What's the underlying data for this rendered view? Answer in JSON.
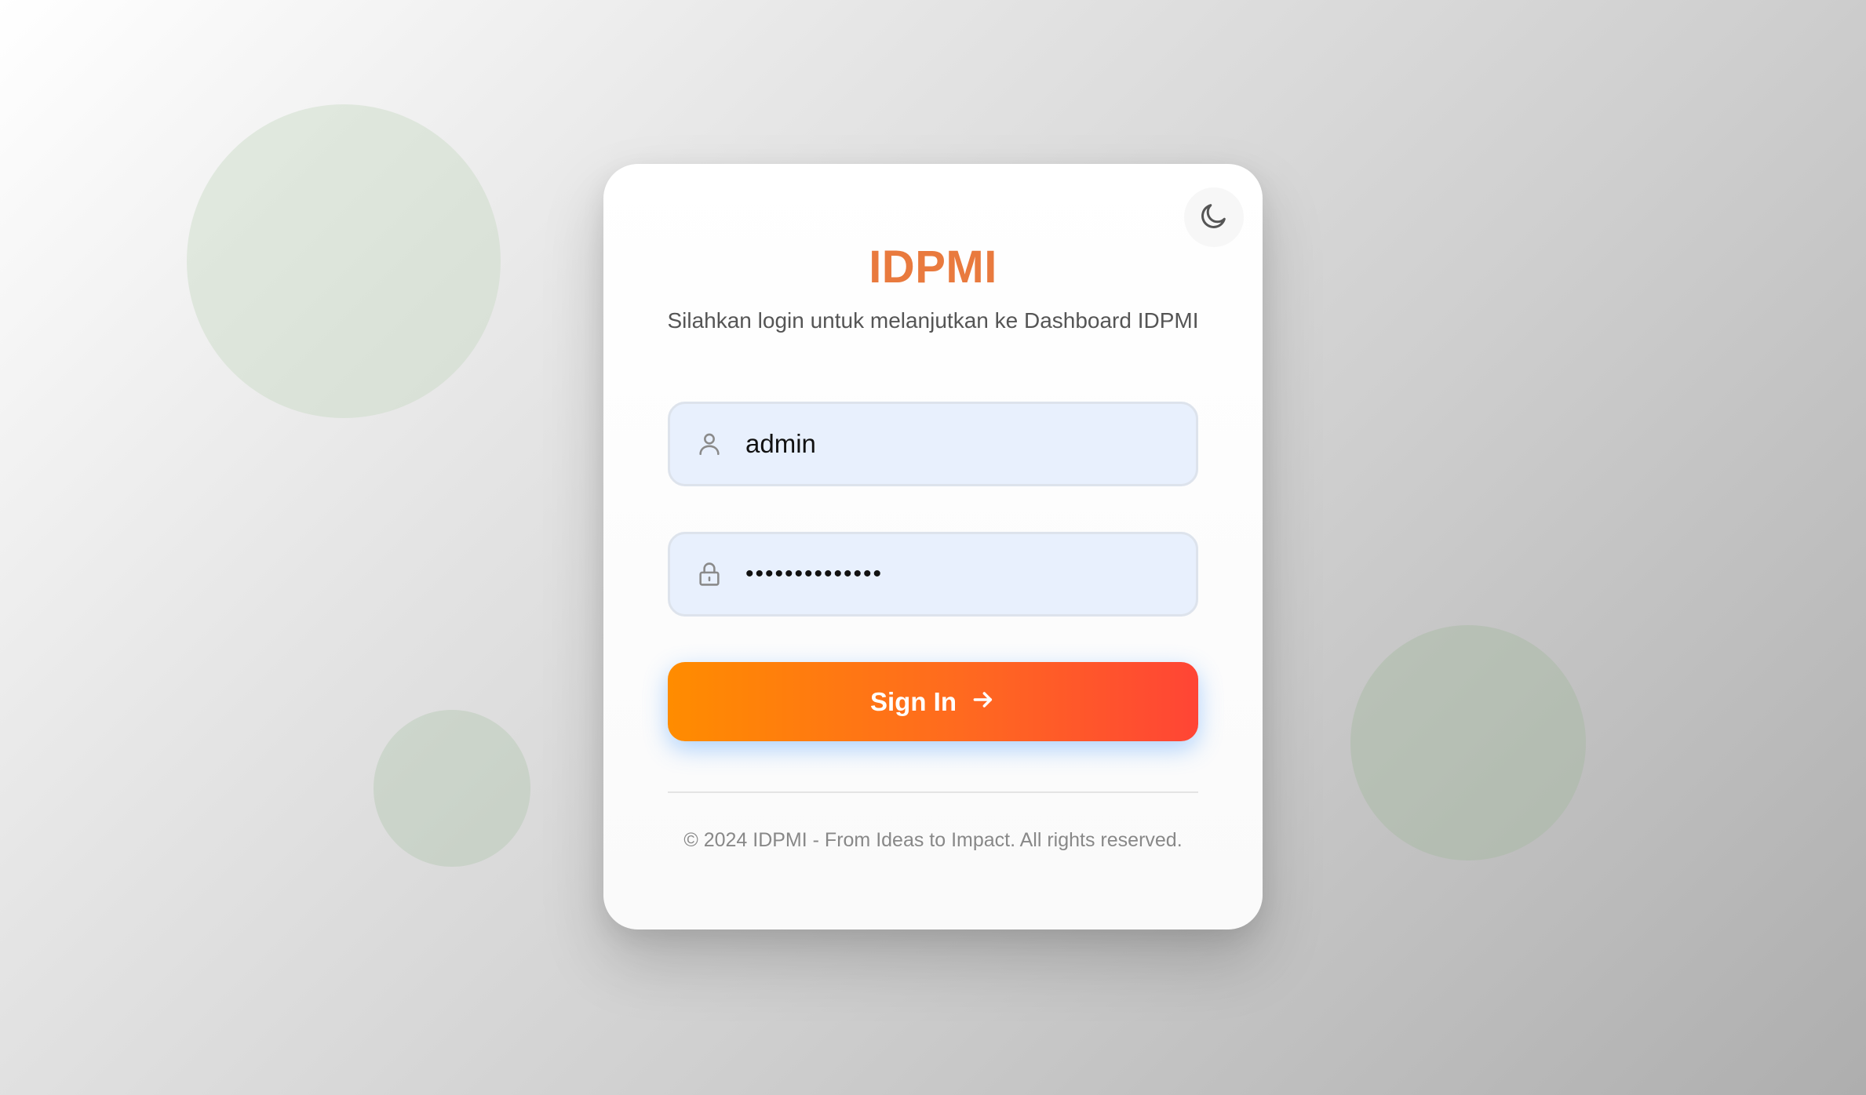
{
  "background": {
    "gradient_colors": [
      "#ffffff",
      "#e6e6e6",
      "#cfcfcf",
      "#aeaeae"
    ]
  },
  "card": {
    "theme_toggle_icon": "moon-icon",
    "title": "IDPMI",
    "subtitle": "Silahkan login untuk melanjutkan ke Dashboard IDPMI",
    "username": {
      "icon": "user-icon",
      "value": "admin"
    },
    "password": {
      "icon": "lock-icon",
      "value": "••••••••••••••"
    },
    "signin": {
      "label": "Sign In",
      "icon": "arrow-right-icon"
    },
    "footer": "© 2024 IDPMI - From Ideas to Impact. All rights reserved."
  },
  "colors": {
    "title": "#e97a3e",
    "button_start": "#ff8c00",
    "button_end": "#ff4535",
    "input_bg": "#e8f0fd"
  }
}
